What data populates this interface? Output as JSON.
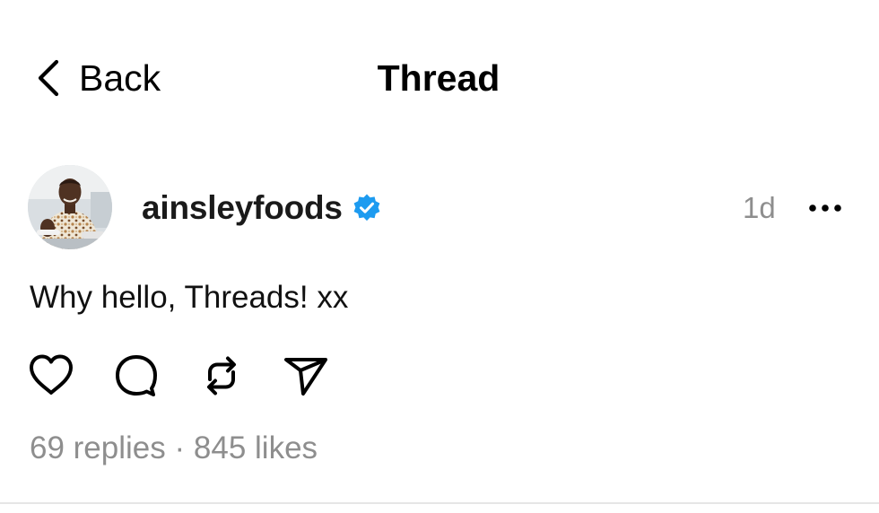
{
  "header": {
    "back_label": "Back",
    "title": "Thread"
  },
  "post": {
    "username": "ainsleyfoods",
    "verified": true,
    "time": "1d",
    "text": "Why hello, Threads! xx",
    "replies": "69 replies",
    "separator": "·",
    "likes": "845 likes"
  },
  "icons": {
    "back": "chevron-left-icon",
    "verified": "verified-badge-icon",
    "more": "more-horizontal-icon",
    "like": "heart-icon",
    "reply": "comment-icon",
    "repost": "repost-icon",
    "share": "send-icon"
  },
  "colors": {
    "verified": "#1d9bf0",
    "secondary_text": "#8e8e8e",
    "divider": "#e6e6e6"
  }
}
